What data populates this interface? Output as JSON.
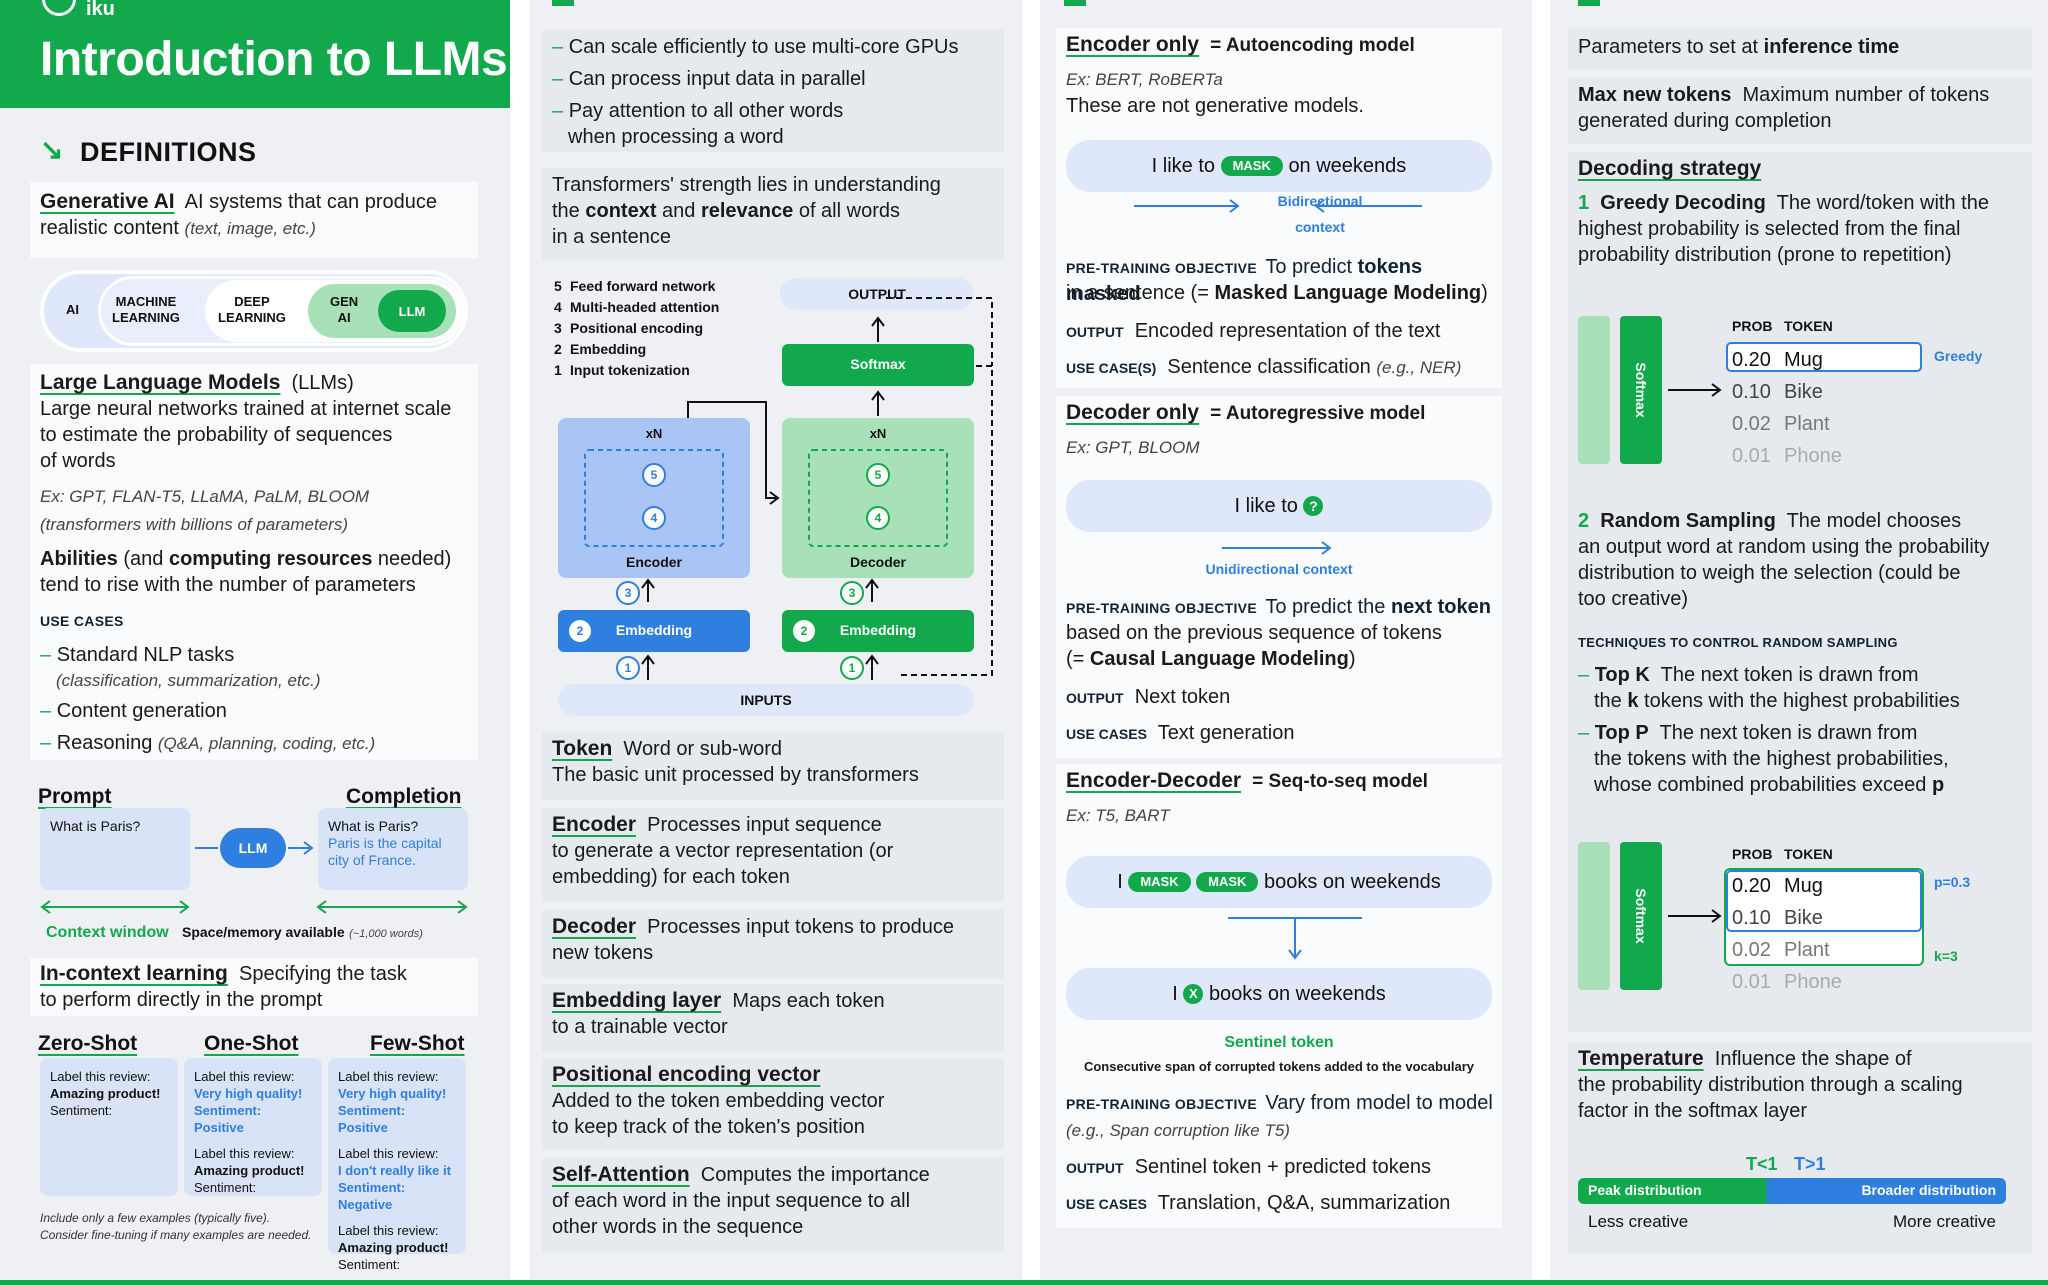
{
  "col1": {
    "logo": "iku",
    "title": "Introduction to LLMs",
    "definitions_heading": "DEFINITIONS",
    "genai": {
      "title": "Generative AI",
      "text": "AI systems that can produce",
      "text2": "realistic content",
      "note": "(text, image, etc.)"
    },
    "circles": {
      "ai": "AI",
      "ml1": "MACHINE",
      "ml2": "LEARNING",
      "dl1": "DEEP",
      "dl2": "LEARNING",
      "gen1": "GEN",
      "gen2": "AI",
      "llm": "LLM"
    },
    "llms": {
      "title": "Large Language Models",
      "suffix": "(LLMs)",
      "l1": "Large neural networks trained at internet scale",
      "l2": "to estimate the probability of sequences",
      "l3": "of words",
      "ex1": "Ex: GPT, FLAN-T5, LLaMA, PaLM, BLOOM",
      "ex2": "(transformers with billions of parameters)",
      "ab_b1": "Abilities",
      "ab_t1": " (and ",
      "ab_b2": "computing resources",
      "ab_t2": " needed)",
      "ab_l2": "tend to rise with the number of parameters",
      "use_cases": "USE CASES",
      "uc1": "Standard NLP tasks",
      "uc1_note": "(classification, summarization, etc.)",
      "uc2": "Content generation",
      "uc3": "Reasoning",
      "uc3_note": "(Q&A, planning, coding, etc.)"
    },
    "prompt": {
      "prompt_label": "Prompt",
      "completion_label": "Completion",
      "prompt_text": "What is Paris?",
      "llm": "LLM",
      "completion_q": "What is Paris?",
      "completion_a1": "Paris is the capital",
      "completion_a2": "city of France.",
      "context_window": "Context window",
      "space": "Space/memory available",
      "words": "(~1,000 words)"
    },
    "icl": {
      "title": "In-context learning",
      "text": "Specifying the task",
      "text2": "to perform directly in the prompt"
    },
    "shots": {
      "zero": "Zero-Shot",
      "one": "One-Shot",
      "few": "Few-Shot",
      "label": "Label this review:",
      "amazing": "Amazing product!",
      "sentiment": "Sentiment:",
      "very_high": "Very high quality!",
      "sent_pos": "Sentiment: Positive",
      "dont_like": "I don't really like it",
      "sent_neg": "Sentiment: Negative",
      "note1": "Include only a few examples (typically five).",
      "note2": "Consider fine-tuning if many examples are needed."
    }
  },
  "col2": {
    "bullets": [
      "Can scale efficiently to use multi-core GPUs",
      "Can process input data in parallel",
      "Pay attention to all other words"
    ],
    "bullet3b": "when processing a word",
    "strength": {
      "l1": "Transformers' strength lies in understanding",
      "l2a": "the ",
      "context": "context",
      "l2b": " and ",
      "relevance": "relevance",
      "l2c": " of all words",
      "l3": "in a sentence"
    },
    "diagram": {
      "legend": [
        "Feed forward network",
        "Multi-headed attention",
        "Positional encoding",
        "Embedding",
        "Input tokenization"
      ],
      "output": "OUTPUT",
      "softmax": "Softmax",
      "xn": "xN",
      "encoder": "Encoder",
      "decoder": "Decoder",
      "embedding": "Embedding",
      "inputs": "INPUTS"
    },
    "defs": [
      {
        "title": "Token",
        "text": "Word or sub-word",
        "text2": "The basic unit processed by transformers"
      },
      {
        "title": "Encoder",
        "text": "Processes input sequence",
        "text2": "to generate a vector representation (or",
        "text3": "embedding) for each token"
      },
      {
        "title": "Decoder",
        "text": "Processes input tokens to produce",
        "text2": "new tokens"
      },
      {
        "title": "Embedding layer",
        "text": "Maps each token",
        "text2": "to a trainable vector"
      },
      {
        "title": "Positional encoding vector",
        "text": "",
        "text2": "Added to the token embedding vector",
        "text3": "to keep track of the token's position"
      },
      {
        "title": "Self-Attention",
        "text": "Computes the importance",
        "text2": "of each word in the input sequence to all",
        "text3": "other words in the sequence"
      }
    ]
  },
  "col3": {
    "enc": {
      "title": "Encoder only",
      "eq": "= Autoencoding model",
      "ex": "Ex: BERT, RoBERTa",
      "not_gen": "These are not generative models.",
      "s_a": "I like to",
      "mask": "MASK",
      "s_b": "on weekends",
      "context": "Bidirectional context",
      "pto": "PRE-TRAINING OBJECTIVE",
      "pto_t1": "To predict ",
      "pto_b1": "tokens masked",
      "pto_t2": "in a sentence (= ",
      "pto_b2": "Masked Language Modeling",
      "pto_t3": ")",
      "out": "OUTPUT",
      "out_t": "Encoded representation of the text",
      "uc": "USE CASE(S)",
      "uc_t": "Sentence classification",
      "uc_note": "(e.g., NER)"
    },
    "dec": {
      "title": "Decoder only",
      "eq": "= Autoregressive model",
      "ex": "Ex: GPT, BLOOM",
      "s": "I like to",
      "q": "?",
      "context": "Unidirectional context",
      "pto": "PRE-TRAINING OBJECTIVE",
      "pto_t1": "To predict the ",
      "pto_b1": "next token",
      "pto_l2": "based on the previous sequence of tokens",
      "pto_l3a": "(= ",
      "pto_b2": "Causal Language Modeling",
      "pto_l3b": ")",
      "out": "OUTPUT",
      "out_t": "Next token",
      "uc": "USE CASES",
      "uc_t": "Text generation"
    },
    "ed": {
      "title": "Encoder-Decoder",
      "eq": "= Seq-to-seq model",
      "ex": "Ex: T5, BART",
      "s1a": "I",
      "mask": "MASK",
      "s1b": "books on weekends",
      "s2a": "I",
      "x": "X",
      "s2b": "books on weekends",
      "sentinel": "Sentinel token",
      "sentinel_note": "Consecutive span of corrupted tokens added to the vocabulary",
      "pto": "PRE-TRAINING OBJECTIVE",
      "pto_t": "Vary from model to model",
      "pto_note": "(e.g., Span corruption like T5)",
      "out": "OUTPUT",
      "out_t": "Sentinel token + predicted tokens",
      "uc": "USE CASES",
      "uc_t": "Translation, Q&A, summarization"
    }
  },
  "col4": {
    "params_a": "Parameters to set at ",
    "params_b": "inference time",
    "max_b": "Max new tokens",
    "max_t": "Maximum number of tokens",
    "max_t2": "generated during completion",
    "dec_title": "Decoding strategy",
    "greedy": {
      "num": "1",
      "title": "Greedy Decoding",
      "t1": "The word/token with the",
      "t2": "highest probability is selected from the final",
      "t3": "probability distribution (prone to repetition)"
    },
    "softmax": "Softmax",
    "prob_head": "PROB",
    "token_head": "TOKEN",
    "table": [
      {
        "p": "0.20",
        "t": "Mug"
      },
      {
        "p": "0.10",
        "t": "Bike"
      },
      {
        "p": "0.02",
        "t": "Plant"
      },
      {
        "p": "0.01",
        "t": "Phone"
      }
    ],
    "greedy_label": "Greedy",
    "random": {
      "num": "2",
      "title": "Random Sampling",
      "t1": "The model chooses",
      "t2": "an output word at random using the probability",
      "t3": "distribution to weigh the selection (could be",
      "t4": "too creative)"
    },
    "techniques": "TECHNIQUES TO CONTROL RANDOM SAMPLING",
    "topk": {
      "b": "Top K",
      "t1": "The next token is drawn from",
      "t2a": "the ",
      "k": "k",
      "t2b": " tokens with the highest probabilities"
    },
    "topp": {
      "b": "Top P",
      "t1": "The next token is drawn from",
      "t2": "the  tokens with the highest probabilities,",
      "t3a": "whose combined probabilities exceed ",
      "p": "p"
    },
    "p_label": "p=0.3",
    "k_label": "k=3",
    "temp": {
      "title": "Temperature",
      "t1": "Influence the shape of",
      "t2": "the probability distribution through a scaling",
      "t3": "factor in the softmax layer",
      "tlt": "T<1",
      "tgt": "T>1",
      "peak": "Peak distribution",
      "broad": "Broader distribution",
      "less": "Less creative",
      "more": "More creative"
    },
    "colors": {
      "green": "#12a84c",
      "blue": "#2f7fe0"
    }
  }
}
